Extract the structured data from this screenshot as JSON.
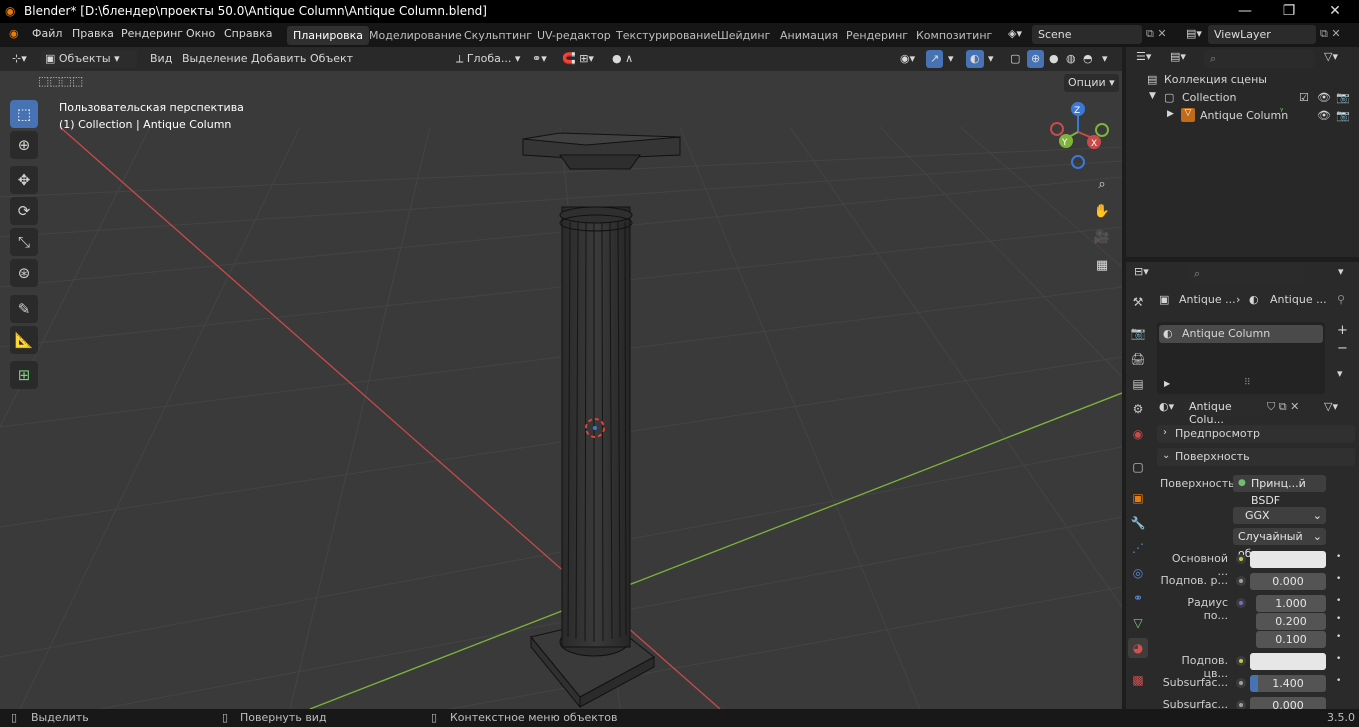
{
  "titlebar": {
    "title": "Blender* [D:\\блендер\\проекты 50.0\\Antique Column\\Antique Column.blend]",
    "minimize": "—",
    "maximize": "❐",
    "close": "✕"
  },
  "menu": {
    "file": "Файл",
    "edit": "Правка",
    "render": "Рендеринг",
    "window": "Окно",
    "help": "Справка"
  },
  "workspaces": [
    "Планировка",
    "Моделирование",
    "Скульптинг",
    "UV-редактор",
    "Текстурирование",
    "Шейдинг",
    "Анимация",
    "Рендеринг",
    "Композитинг"
  ],
  "scene": {
    "name": "Scene",
    "view_layer": "ViewLayer"
  },
  "viewport_header": {
    "mode": "Объекты",
    "view": "Вид",
    "select": "Выделение",
    "add": "Добавить",
    "object": "Объект",
    "orientation": "Глоба...",
    "options": "Опции"
  },
  "viewport": {
    "perspective_label": "Пользовательская перспектива",
    "collection_label": "(1) Collection | Antique Column",
    "gizmo": {
      "x": "X",
      "y": "Y",
      "z": "Z"
    }
  },
  "outliner": {
    "scene_collection": "Коллекция сцены",
    "collection": "Collection",
    "object": "Antique Column"
  },
  "properties": {
    "breadcrumb_object": "Antique ...",
    "breadcrumb_material": "Antique ...",
    "slot_name": "Antique Column",
    "material_name": "Antique Colu...",
    "preview_panel": "Предпросмотр",
    "surface_panel": "Поверхность",
    "surface_label": "Поверхность",
    "surface_value": "Принц...й BSDF",
    "distribution": "GGX",
    "subsurface_method": "Случайный об...",
    "base_color_label": "Основной ...",
    "subsurface_label": "Подпов. р...",
    "subsurface_value": "0.000",
    "radius_label": "Радиус по...",
    "radius": [
      "1.000",
      "0.200",
      "0.100"
    ],
    "subsurface_color_label": "Подпов. цв...",
    "subsurface_ior_label": "Subsurfac...",
    "subsurface_ior_value": "1.400",
    "subsurface_aniso_label": "Subsurfac...",
    "subsurface_aniso_value": "0.000"
  },
  "statusbar": {
    "select": "Выделить",
    "rotate": "Повернуть вид",
    "context": "Контекстное меню объектов",
    "version": "3.5.0"
  },
  "colors": {
    "accent": "#4772b3",
    "x_axis": "#c94a4a",
    "y_axis": "#7fb43a",
    "z_axis": "#3b79d8",
    "orange": "#e87d0d"
  }
}
